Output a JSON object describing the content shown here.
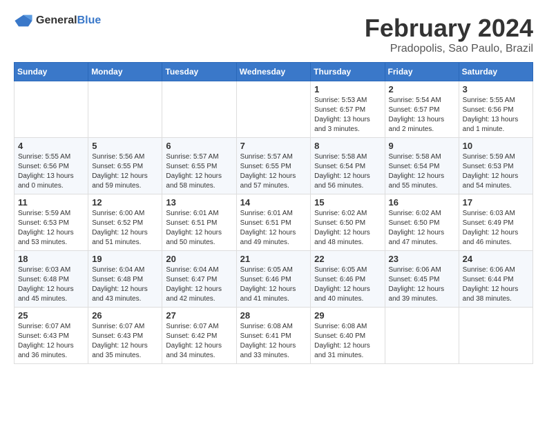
{
  "logo": {
    "text_general": "General",
    "text_blue": "Blue"
  },
  "title": {
    "month_year": "February 2024",
    "location": "Pradopolis, Sao Paulo, Brazil"
  },
  "headers": [
    "Sunday",
    "Monday",
    "Tuesday",
    "Wednesday",
    "Thursday",
    "Friday",
    "Saturday"
  ],
  "weeks": [
    [
      {
        "day": "",
        "info": ""
      },
      {
        "day": "",
        "info": ""
      },
      {
        "day": "",
        "info": ""
      },
      {
        "day": "",
        "info": ""
      },
      {
        "day": "1",
        "info": "Sunrise: 5:53 AM\nSunset: 6:57 PM\nDaylight: 13 hours\nand 3 minutes."
      },
      {
        "day": "2",
        "info": "Sunrise: 5:54 AM\nSunset: 6:57 PM\nDaylight: 13 hours\nand 2 minutes."
      },
      {
        "day": "3",
        "info": "Sunrise: 5:55 AM\nSunset: 6:56 PM\nDaylight: 13 hours\nand 1 minute."
      }
    ],
    [
      {
        "day": "4",
        "info": "Sunrise: 5:55 AM\nSunset: 6:56 PM\nDaylight: 13 hours\nand 0 minutes."
      },
      {
        "day": "5",
        "info": "Sunrise: 5:56 AM\nSunset: 6:55 PM\nDaylight: 12 hours\nand 59 minutes."
      },
      {
        "day": "6",
        "info": "Sunrise: 5:57 AM\nSunset: 6:55 PM\nDaylight: 12 hours\nand 58 minutes."
      },
      {
        "day": "7",
        "info": "Sunrise: 5:57 AM\nSunset: 6:55 PM\nDaylight: 12 hours\nand 57 minutes."
      },
      {
        "day": "8",
        "info": "Sunrise: 5:58 AM\nSunset: 6:54 PM\nDaylight: 12 hours\nand 56 minutes."
      },
      {
        "day": "9",
        "info": "Sunrise: 5:58 AM\nSunset: 6:54 PM\nDaylight: 12 hours\nand 55 minutes."
      },
      {
        "day": "10",
        "info": "Sunrise: 5:59 AM\nSunset: 6:53 PM\nDaylight: 12 hours\nand 54 minutes."
      }
    ],
    [
      {
        "day": "11",
        "info": "Sunrise: 5:59 AM\nSunset: 6:53 PM\nDaylight: 12 hours\nand 53 minutes."
      },
      {
        "day": "12",
        "info": "Sunrise: 6:00 AM\nSunset: 6:52 PM\nDaylight: 12 hours\nand 51 minutes."
      },
      {
        "day": "13",
        "info": "Sunrise: 6:01 AM\nSunset: 6:51 PM\nDaylight: 12 hours\nand 50 minutes."
      },
      {
        "day": "14",
        "info": "Sunrise: 6:01 AM\nSunset: 6:51 PM\nDaylight: 12 hours\nand 49 minutes."
      },
      {
        "day": "15",
        "info": "Sunrise: 6:02 AM\nSunset: 6:50 PM\nDaylight: 12 hours\nand 48 minutes."
      },
      {
        "day": "16",
        "info": "Sunrise: 6:02 AM\nSunset: 6:50 PM\nDaylight: 12 hours\nand 47 minutes."
      },
      {
        "day": "17",
        "info": "Sunrise: 6:03 AM\nSunset: 6:49 PM\nDaylight: 12 hours\nand 46 minutes."
      }
    ],
    [
      {
        "day": "18",
        "info": "Sunrise: 6:03 AM\nSunset: 6:48 PM\nDaylight: 12 hours\nand 45 minutes."
      },
      {
        "day": "19",
        "info": "Sunrise: 6:04 AM\nSunset: 6:48 PM\nDaylight: 12 hours\nand 43 minutes."
      },
      {
        "day": "20",
        "info": "Sunrise: 6:04 AM\nSunset: 6:47 PM\nDaylight: 12 hours\nand 42 minutes."
      },
      {
        "day": "21",
        "info": "Sunrise: 6:05 AM\nSunset: 6:46 PM\nDaylight: 12 hours\nand 41 minutes."
      },
      {
        "day": "22",
        "info": "Sunrise: 6:05 AM\nSunset: 6:46 PM\nDaylight: 12 hours\nand 40 minutes."
      },
      {
        "day": "23",
        "info": "Sunrise: 6:06 AM\nSunset: 6:45 PM\nDaylight: 12 hours\nand 39 minutes."
      },
      {
        "day": "24",
        "info": "Sunrise: 6:06 AM\nSunset: 6:44 PM\nDaylight: 12 hours\nand 38 minutes."
      }
    ],
    [
      {
        "day": "25",
        "info": "Sunrise: 6:07 AM\nSunset: 6:43 PM\nDaylight: 12 hours\nand 36 minutes."
      },
      {
        "day": "26",
        "info": "Sunrise: 6:07 AM\nSunset: 6:43 PM\nDaylight: 12 hours\nand 35 minutes."
      },
      {
        "day": "27",
        "info": "Sunrise: 6:07 AM\nSunset: 6:42 PM\nDaylight: 12 hours\nand 34 minutes."
      },
      {
        "day": "28",
        "info": "Sunrise: 6:08 AM\nSunset: 6:41 PM\nDaylight: 12 hours\nand 33 minutes."
      },
      {
        "day": "29",
        "info": "Sunrise: 6:08 AM\nSunset: 6:40 PM\nDaylight: 12 hours\nand 31 minutes."
      },
      {
        "day": "",
        "info": ""
      },
      {
        "day": "",
        "info": ""
      }
    ]
  ]
}
